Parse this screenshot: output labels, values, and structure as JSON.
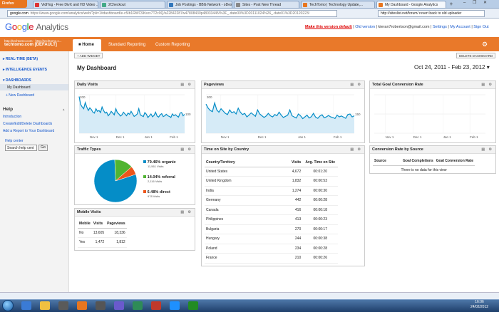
{
  "browser": {
    "button": "Firefox",
    "tabs": [
      {
        "label": "VidHog - Free DivX and HD Video ...",
        "color": "#d33"
      },
      {
        "label": "2Checkout",
        "color": "#4a8"
      },
      {
        "label": "Job Postings - BBG Network - oDesk",
        "color": "#37b"
      },
      {
        "label": "Sites - Post New Thread",
        "color": "#888"
      },
      {
        "label": "TechTomo | Technology Update,...",
        "color": "#e8761f"
      },
      {
        "label": "My Dashboard - Google Analytics",
        "color": "#e8761f"
      }
    ],
    "new_tab": "+",
    "window_controls": "– ❐ ✕",
    "url_domain": "google.com",
    "url": "https://www.google.com/analytics/web/?pli=1#dashboard/e-c5Ib1RWC9Ksxx7T2c0Q/a22842287w47808430p48033445/%3F_.date00%3D20111024%26_.date01%3D20120223/",
    "search": "http://siteslist.net/forum/ revert back to old uploader"
  },
  "header": {
    "logo_parts": [
      "G",
      "o",
      "o",
      "g",
      "l",
      "e"
    ],
    "logo_product": "Analytics",
    "make_default": "Make this version default",
    "old_version": "Old version",
    "email": "kieran7robertson@gmail.com",
    "settings": "Settings",
    "my_account": "My Account",
    "sign_out": "Sign Out",
    "sep": "|"
  },
  "nav": {
    "account_url": "http://techtomo.com - http://techtomo.c...",
    "account_name": "techtomo.com [DEFAULT]",
    "tabs": [
      "Home",
      "Standard Reporting",
      "Custom Reporting"
    ]
  },
  "sidebar": {
    "realtime": "REAL-TIME (BETA)",
    "intelligence": "INTELLIGENCE EVENTS",
    "dashboards": "DASHBOARDS",
    "my_dashboard": "My Dashboard",
    "new_dashboard": "+ New Dashboard",
    "help_title": "Help",
    "help_links": [
      "Introduction",
      "Create/Edit/Delete Dashboards",
      "Add a Report to Your Dashboard"
    ],
    "help_center": "Help center",
    "search_placeholder": "Search help cent",
    "go": "Go"
  },
  "toolbar": {
    "add_widget": "+ ADD WIDGET",
    "delete_dashboard": "DELETE DASHBOARD"
  },
  "dashboard": {
    "title": "My Dashboard",
    "date_range": "Oct 24, 2011 - Feb 23, 2012 ▾"
  },
  "widgets": {
    "daily_visits": {
      "title": "Daily Visits",
      "y_top": "200",
      "y_mid": "100",
      "x_ticks": [
        "Nov 1",
        "Dec 1",
        "Jan 1",
        "Feb 1"
      ]
    },
    "pageviews": {
      "title": "Pageviews",
      "y_top": "300",
      "y_mid": "150",
      "x_ticks": [
        "Nov 1",
        "Dec 1",
        "Jan 1",
        "Feb 1"
      ]
    },
    "goal_conversion": {
      "title": "Total Goal Conversion Rate",
      "x_ticks": [
        "Nov 1",
        "Dec 1",
        "Jan 1",
        "Feb 1"
      ]
    },
    "traffic_types": {
      "title": "Traffic Types",
      "items": [
        {
          "pct": "79.46% organic",
          "visits": "11,561 Visits",
          "color": "#058dc7"
        },
        {
          "pct": "14.04% referral",
          "visits": "2,116 Visits",
          "color": "#50b432"
        },
        {
          "pct": "6.48% direct",
          "visits": "978 Visits",
          "color": "#ed561b"
        }
      ]
    },
    "mobile": {
      "title": "Mobile Visits",
      "headers": [
        "Mobile",
        "Visits",
        "Pageviews"
      ],
      "rows": [
        [
          "No",
          "13,605",
          "18,336"
        ],
        [
          "Yes",
          "1,472",
          "1,812"
        ]
      ]
    },
    "time_on_site": {
      "title": "Time on Site by Country",
      "headers": [
        "Country/Territory",
        "Visits",
        "Avg. Time on Site"
      ],
      "rows": [
        [
          "United States",
          "4,672",
          "00:01:20"
        ],
        [
          "United Kingdom",
          "1,832",
          "00:00:53"
        ],
        [
          "India",
          "1,274",
          "00:00:30"
        ],
        [
          "Germany",
          "442",
          "00:00:28"
        ],
        [
          "Canada",
          "416",
          "00:00:18"
        ],
        [
          "Philippines",
          "413",
          "00:00:23"
        ],
        [
          "Bulgaria",
          "270",
          "00:00:17"
        ],
        [
          "Hungary",
          "244",
          "00:00:38"
        ],
        [
          "Poland",
          "234",
          "00:00:28"
        ],
        [
          "France",
          "210",
          "00:00:26"
        ]
      ]
    },
    "conv_source": {
      "title": "Conversion Rate by Source",
      "headers": [
        "Source",
        "Goal Completions",
        "Goal Conversion Rate"
      ],
      "empty": "There is no data for this view"
    }
  },
  "clock": {
    "time": "16:06",
    "date": "24/02/2012"
  },
  "chart_data": [
    {
      "type": "area",
      "title": "Daily Visits",
      "x": [
        "Nov 1",
        "Dec 1",
        "Jan 1",
        "Feb 1"
      ],
      "ylim": [
        0,
        200
      ],
      "values": [
        210,
        165,
        150,
        140,
        175,
        150,
        130,
        145,
        135,
        120,
        115,
        140,
        125,
        130,
        118,
        150,
        130,
        115,
        120,
        100,
        110,
        125,
        115,
        105,
        140,
        118,
        110,
        98,
        105,
        120,
        110,
        100,
        115,
        108,
        125,
        110,
        96,
        102,
        110,
        140,
        105,
        100,
        95,
        118,
        108,
        90,
        100,
        110,
        94,
        102,
        120,
        98,
        92,
        105,
        112,
        95,
        100,
        108,
        100,
        96,
        90,
        110,
        100,
        106,
        98,
        92,
        115,
        118,
        100,
        108
      ]
    },
    {
      "type": "area",
      "title": "Pageviews",
      "x": [
        "Nov 1",
        "Dec 1",
        "Jan 1",
        "Feb 1"
      ],
      "ylim": [
        0,
        300
      ],
      "values": [
        250,
        215,
        195,
        185,
        260,
        200,
        180,
        210,
        190,
        170,
        160,
        200,
        175,
        185,
        165,
        215,
        180,
        160,
        170,
        140,
        155,
        175,
        160,
        145,
        200,
        165,
        150,
        135,
        148,
        170,
        150,
        140,
        160,
        150,
        180,
        155,
        135,
        145,
        155,
        200,
        150,
        140,
        130,
        165,
        150,
        125,
        140,
        155,
        130,
        142,
        170,
        138,
        128,
        148,
        158,
        132,
        140,
        152,
        140,
        135,
        126,
        155,
        140,
        148,
        138,
        128,
        160,
        165,
        140,
        150
      ]
    },
    {
      "type": "area",
      "title": "Total Goal Conversion Rate",
      "x": [
        "Nov 1",
        "Dec 1",
        "Jan 1",
        "Feb 1"
      ],
      "values": []
    },
    {
      "type": "pie",
      "title": "Traffic Types",
      "categories": [
        "organic",
        "referral",
        "direct"
      ],
      "values": [
        79.46,
        14.04,
        6.48
      ]
    }
  ]
}
